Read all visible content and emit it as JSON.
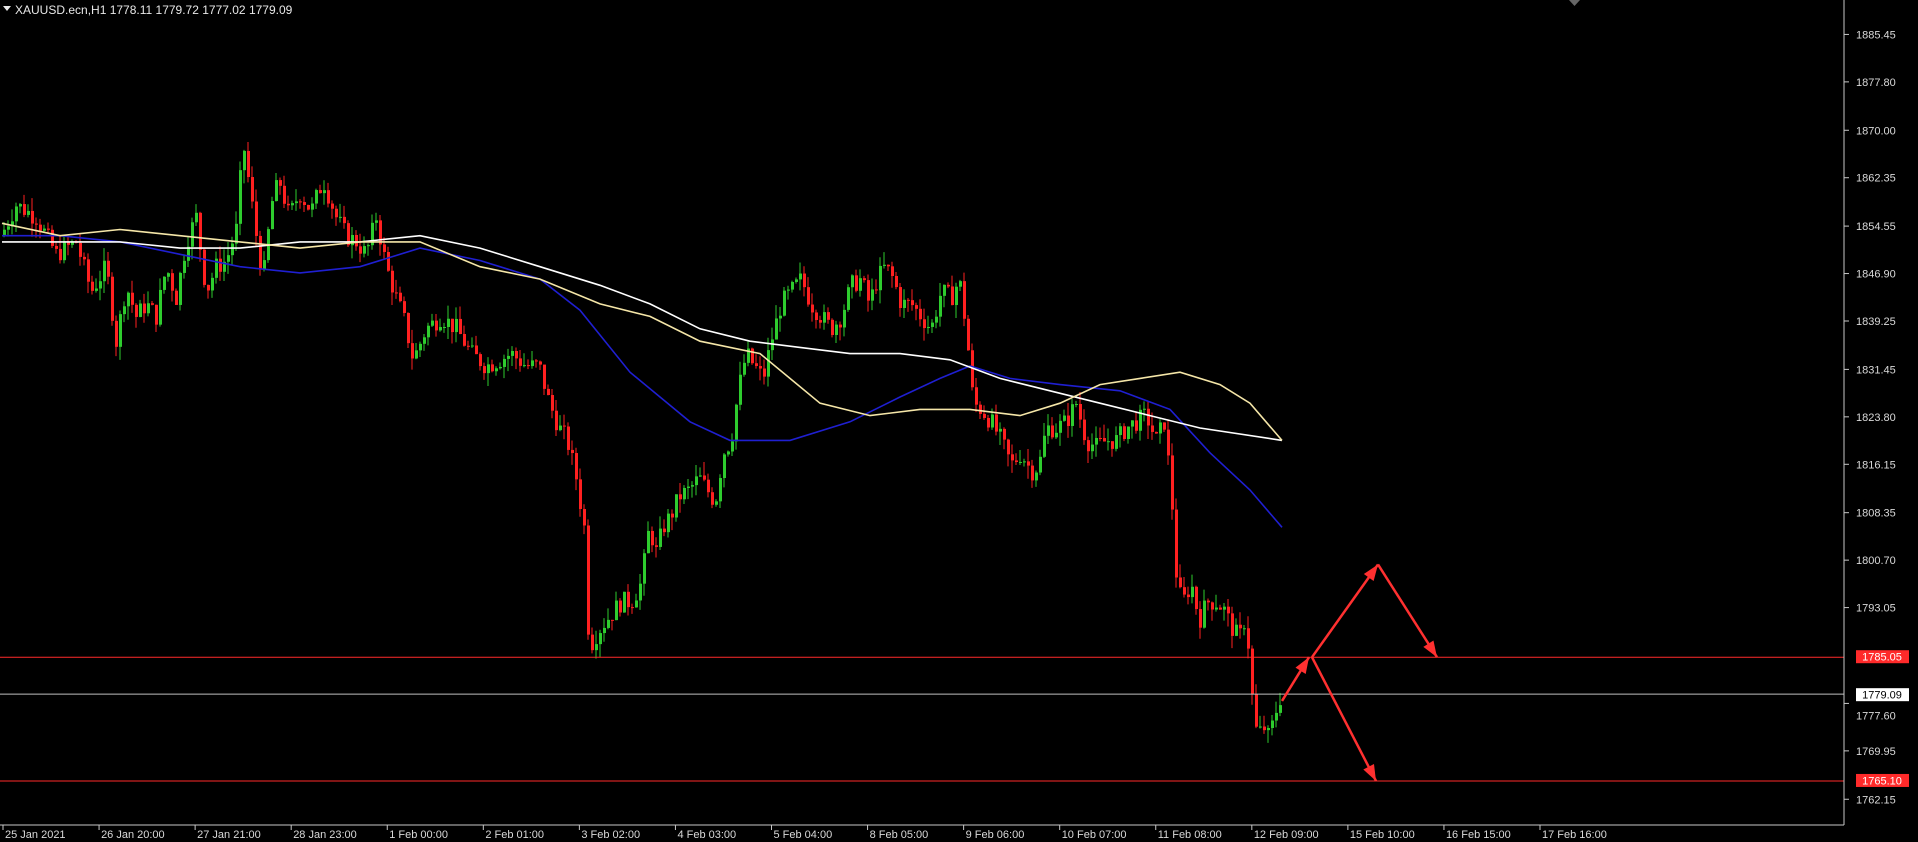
{
  "header": {
    "symbol_line": "XAUUSD.ecn,H1  1778.11 1779.72 1777.02 1779.09"
  },
  "colors": {
    "background": "#000000",
    "axis": "#c8c8c8",
    "bull_candle": "#2ecc2e",
    "bear_candle": "#ff2020",
    "ma_blue": "#1f1fd1",
    "ma_white": "#ffffff",
    "ma_yellow": "#f5e6a8",
    "level_line": "#ff2a2a",
    "current_line": "#bfbfbf",
    "arrow": "#ff3030"
  },
  "chart_data": {
    "type": "candlestick",
    "symbol": "XAUUSD.ecn",
    "timeframe": "H1",
    "ohlc_last": {
      "open": 1778.11,
      "high": 1779.72,
      "low": 1777.02,
      "close": 1779.09
    },
    "ylim": [
      1758.0,
      1891.0
    ],
    "y_ticks": [
      "1885.45",
      "1877.80",
      "1870.00",
      "1862.35",
      "1854.55",
      "1846.90",
      "1839.25",
      "1831.45",
      "1823.80",
      "1816.15",
      "1808.35",
      "1800.70",
      "1793.05",
      "1777.60",
      "1769.95",
      "1762.15"
    ],
    "x_ticks": [
      "25 Jan 2021",
      "26 Jan 20:00",
      "27 Jan 21:00",
      "28 Jan 23:00",
      "1 Feb 00:00",
      "2 Feb 01:00",
      "3 Feb 02:00",
      "4 Feb 03:00",
      "5 Feb 04:00",
      "8 Feb 05:00",
      "9 Feb 06:00",
      "10 Feb 07:00",
      "11 Feb 08:00",
      "12 Feb 09:00",
      "15 Feb 10:00",
      "16 Feb 15:00",
      "17 Feb 16:00"
    ],
    "price_path": [
      [
        0,
        1853
      ],
      [
        15,
        1858
      ],
      [
        35,
        1856
      ],
      [
        55,
        1850
      ],
      [
        75,
        1852
      ],
      [
        90,
        1844
      ],
      [
        105,
        1848
      ],
      [
        115,
        1836
      ],
      [
        125,
        1845
      ],
      [
        135,
        1840
      ],
      [
        145,
        1842
      ],
      [
        155,
        1840
      ],
      [
        165,
        1848
      ],
      [
        175,
        1843
      ],
      [
        185,
        1852
      ],
      [
        195,
        1856
      ],
      [
        205,
        1844
      ],
      [
        215,
        1848
      ],
      [
        225,
        1849
      ],
      [
        235,
        1854
      ],
      [
        242,
        1868
      ],
      [
        249,
        1860
      ],
      [
        256,
        1852
      ],
      [
        262,
        1846
      ],
      [
        270,
        1858
      ],
      [
        278,
        1862
      ],
      [
        288,
        1856
      ],
      [
        298,
        1860
      ],
      [
        310,
        1857
      ],
      [
        322,
        1862
      ],
      [
        335,
        1856
      ],
      [
        345,
        1853
      ],
      [
        355,
        1852
      ],
      [
        365,
        1850
      ],
      [
        375,
        1856
      ],
      [
        385,
        1848
      ],
      [
        395,
        1843
      ],
      [
        402,
        1840
      ],
      [
        412,
        1833
      ],
      [
        425,
        1838
      ],
      [
        440,
        1840
      ],
      [
        455,
        1838
      ],
      [
        470,
        1834
      ],
      [
        485,
        1832
      ],
      [
        498,
        1833
      ],
      [
        510,
        1834
      ],
      [
        525,
        1832
      ],
      [
        538,
        1832
      ],
      [
        548,
        1826
      ],
      [
        558,
        1822
      ],
      [
        566,
        1820
      ],
      [
        575,
        1814
      ],
      [
        583,
        1806
      ],
      [
        588,
        1786
      ],
      [
        592,
        1788
      ],
      [
        600,
        1790
      ],
      [
        610,
        1792
      ],
      [
        620,
        1794
      ],
      [
        630,
        1794
      ],
      [
        640,
        1797
      ],
      [
        648,
        1806
      ],
      [
        655,
        1802
      ],
      [
        662,
        1806
      ],
      [
        670,
        1808
      ],
      [
        678,
        1811
      ],
      [
        688,
        1812
      ],
      [
        698,
        1814
      ],
      [
        706,
        1812
      ],
      [
        714,
        1810
      ],
      [
        722,
        1818
      ],
      [
        730,
        1820
      ],
      [
        737,
        1828
      ],
      [
        745,
        1834
      ],
      [
        753,
        1832
      ],
      [
        762,
        1830
      ],
      [
        770,
        1836
      ],
      [
        780,
        1842
      ],
      [
        790,
        1844
      ],
      [
        800,
        1846
      ],
      [
        810,
        1842
      ],
      [
        820,
        1840
      ],
      [
        830,
        1838
      ],
      [
        840,
        1840
      ],
      [
        850,
        1845
      ],
      [
        860,
        1846
      ],
      [
        868,
        1842
      ],
      [
        876,
        1846
      ],
      [
        884,
        1848
      ],
      [
        892,
        1846
      ],
      [
        900,
        1842
      ],
      [
        910,
        1842
      ],
      [
        920,
        1840
      ],
      [
        930,
        1838
      ],
      [
        940,
        1844
      ],
      [
        950,
        1843
      ],
      [
        958,
        1846
      ],
      [
        965,
        1838
      ],
      [
        972,
        1826
      ],
      [
        980,
        1825
      ],
      [
        990,
        1823
      ],
      [
        1000,
        1820
      ],
      [
        1010,
        1816
      ],
      [
        1020,
        1818
      ],
      [
        1030,
        1815
      ],
      [
        1038,
        1816
      ],
      [
        1045,
        1822
      ],
      [
        1055,
        1822
      ],
      [
        1065,
        1823
      ],
      [
        1075,
        1826
      ],
      [
        1085,
        1820
      ],
      [
        1095,
        1819
      ],
      [
        1105,
        1820
      ],
      [
        1115,
        1820
      ],
      [
        1125,
        1822
      ],
      [
        1135,
        1823
      ],
      [
        1145,
        1824
      ],
      [
        1155,
        1820
      ],
      [
        1163,
        1823
      ],
      [
        1170,
        1812
      ],
      [
        1176,
        1796
      ],
      [
        1182,
        1794
      ],
      [
        1190,
        1797
      ],
      [
        1198,
        1791
      ],
      [
        1206,
        1794
      ],
      [
        1214,
        1794
      ],
      [
        1222,
        1793
      ],
      [
        1230,
        1790
      ],
      [
        1238,
        1788
      ],
      [
        1245,
        1792
      ],
      [
        1250,
        1780
      ],
      [
        1256,
        1772
      ],
      [
        1262,
        1774
      ],
      [
        1268,
        1772
      ],
      [
        1274,
        1776
      ],
      [
        1280,
        1779
      ]
    ],
    "moving_averages": [
      {
        "color": "blue",
        "points": [
          [
            2,
            1853
          ],
          [
            60,
            1853
          ],
          [
            120,
            1852
          ],
          [
            180,
            1850
          ],
          [
            240,
            1848
          ],
          [
            300,
            1847
          ],
          [
            360,
            1848
          ],
          [
            420,
            1851
          ],
          [
            480,
            1849
          ],
          [
            540,
            1846
          ],
          [
            580,
            1841
          ],
          [
            630,
            1831
          ],
          [
            690,
            1823
          ],
          [
            730,
            1820
          ],
          [
            790,
            1820
          ],
          [
            850,
            1823
          ],
          [
            900,
            1827
          ],
          [
            940,
            1830
          ],
          [
            970,
            1832
          ],
          [
            1010,
            1830
          ],
          [
            1060,
            1829
          ],
          [
            1120,
            1828
          ],
          [
            1170,
            1825
          ],
          [
            1210,
            1818
          ],
          [
            1250,
            1812
          ],
          [
            1282,
            1806
          ]
        ]
      },
      {
        "color": "white",
        "points": [
          [
            2,
            1852
          ],
          [
            60,
            1852
          ],
          [
            120,
            1852
          ],
          [
            180,
            1851
          ],
          [
            240,
            1851
          ],
          [
            300,
            1852
          ],
          [
            360,
            1852
          ],
          [
            420,
            1853
          ],
          [
            480,
            1851
          ],
          [
            540,
            1848
          ],
          [
            600,
            1845
          ],
          [
            650,
            1842
          ],
          [
            700,
            1838
          ],
          [
            750,
            1836
          ],
          [
            800,
            1835
          ],
          [
            850,
            1834
          ],
          [
            900,
            1834
          ],
          [
            950,
            1833
          ],
          [
            1000,
            1830
          ],
          [
            1050,
            1828
          ],
          [
            1100,
            1826
          ],
          [
            1150,
            1824
          ],
          [
            1200,
            1822
          ],
          [
            1282,
            1820
          ]
        ]
      },
      {
        "color": "yellow",
        "points": [
          [
            2,
            1855
          ],
          [
            60,
            1853
          ],
          [
            120,
            1854
          ],
          [
            180,
            1853
          ],
          [
            240,
            1852
          ],
          [
            300,
            1851
          ],
          [
            360,
            1852
          ],
          [
            420,
            1852
          ],
          [
            480,
            1848
          ],
          [
            540,
            1846
          ],
          [
            600,
            1842
          ],
          [
            650,
            1840
          ],
          [
            700,
            1836
          ],
          [
            760,
            1834
          ],
          [
            820,
            1826
          ],
          [
            870,
            1824
          ],
          [
            920,
            1825
          ],
          [
            970,
            1825
          ],
          [
            1020,
            1824
          ],
          [
            1060,
            1826
          ],
          [
            1100,
            1829
          ],
          [
            1140,
            1830
          ],
          [
            1180,
            1831
          ],
          [
            1220,
            1829
          ],
          [
            1250,
            1826
          ],
          [
            1282,
            1820
          ]
        ]
      }
    ],
    "level_lines": [
      {
        "price": 1785.05,
        "label": "1785.05",
        "style": "red"
      },
      {
        "price": 1779.09,
        "label": "1779.09",
        "style": "current"
      },
      {
        "price": 1765.1,
        "label": "1765.10",
        "style": "red"
      }
    ],
    "projection_arrows": [
      {
        "from": [
          1312,
          1785.05
        ],
        "to": [
          1378,
          1800.0
        ]
      },
      {
        "from": [
          1378,
          1800.0
        ],
        "to": [
          1437,
          1785.05
        ]
      },
      {
        "from": [
          1312,
          1785.05
        ],
        "to": [
          1376,
          1765.1
        ]
      },
      {
        "from": [
          1282,
          1778.0
        ],
        "to": [
          1309,
          1785.05
        ]
      }
    ]
  }
}
